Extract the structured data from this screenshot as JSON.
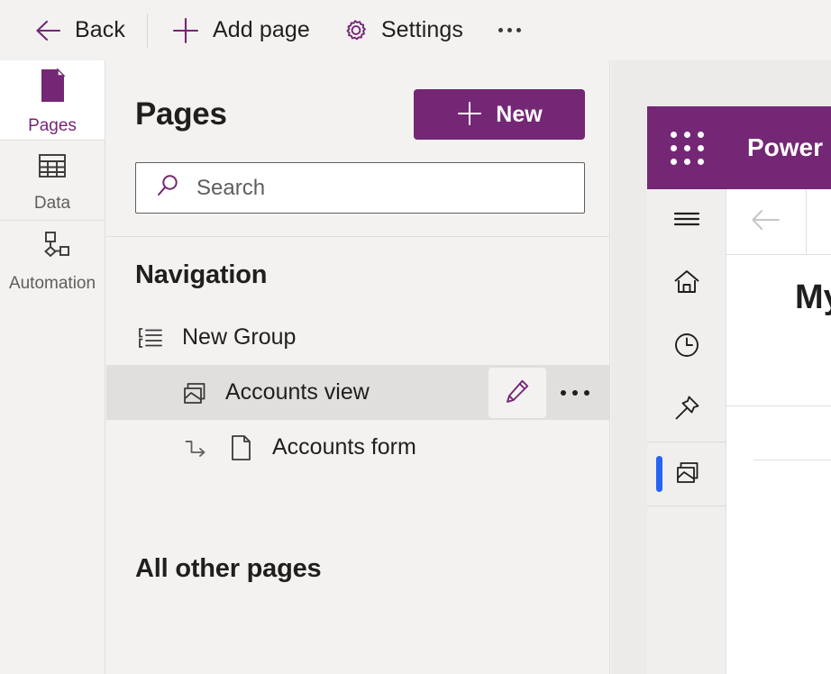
{
  "command_bar": {
    "items": [
      {
        "label": "Back",
        "icon": "back-arrow-icon"
      },
      {
        "label": "Add page",
        "icon": "plus-icon"
      },
      {
        "label": "Settings",
        "icon": "gear-icon"
      }
    ],
    "overflow_label": "More commands"
  },
  "rail": {
    "items": [
      {
        "label": "Pages",
        "icon": "page-icon",
        "selected": true
      },
      {
        "label": "Data",
        "icon": "table-icon",
        "selected": false
      },
      {
        "label": "Automation",
        "icon": "flow-icon",
        "selected": false
      }
    ]
  },
  "pages_panel": {
    "title": "Pages",
    "new_button": {
      "label": "New",
      "icon": "plus-icon"
    },
    "search": {
      "value": "",
      "placeholder": "Search",
      "icon": "search-icon"
    },
    "navigation_heading": "Navigation",
    "tree": [
      {
        "label": "New Group",
        "icon": "group-list-icon",
        "level": 1,
        "selected": false,
        "actions": []
      },
      {
        "label": "Accounts view",
        "icon": "view-icon",
        "level": 2,
        "selected": true,
        "actions": [
          {
            "name": "edit",
            "icon": "pencil-icon"
          },
          {
            "name": "more",
            "icon": "ellipsis-icon"
          }
        ]
      },
      {
        "label": "Accounts form",
        "icon": "document-icon",
        "sub_icon": "subgrid-arrow-icon",
        "level": 3,
        "selected": false,
        "actions": []
      }
    ],
    "all_other_pages_heading": "All other pages"
  },
  "preview": {
    "app_title": "Power",
    "waffle_icon": "waffle-grid-icon",
    "rail_icons": [
      {
        "name": "hamburger-icon",
        "active": false
      },
      {
        "name": "home-icon",
        "active": false
      },
      {
        "name": "recent-clock-icon",
        "active": false
      },
      {
        "name": "pin-icon",
        "active": false
      },
      {
        "name": "view-icon",
        "active": true
      }
    ],
    "toolbar_icons": [
      {
        "name": "back-arrow-icon"
      },
      {
        "name": "check-mark-icon"
      }
    ],
    "view_title": "My"
  },
  "colors": {
    "brand_purple": "#742774",
    "panel_bg": "#f3f2f1",
    "selected_row": "#e1dfdd",
    "accent_blue": "#2564f5",
    "check_green": "#4a9e54",
    "text_primary": "#201f1e",
    "text_secondary": "#605e5c"
  }
}
